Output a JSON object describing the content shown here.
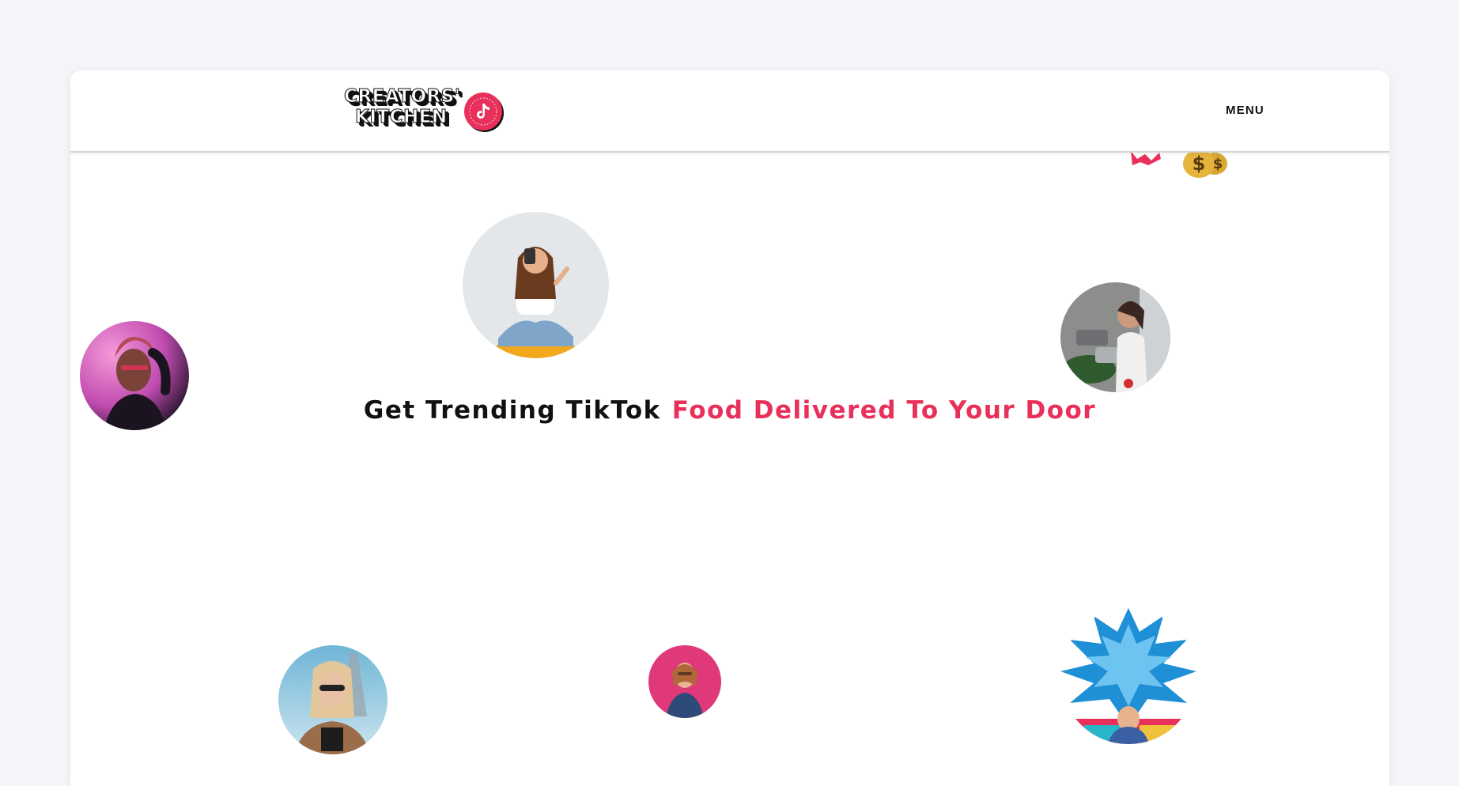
{
  "header": {
    "logo": {
      "line1": "CREATORS'",
      "line2": "KITCHEN",
      "badge_icon": "tiktok-note-icon",
      "badge_color": "#e8305a"
    },
    "menu_label": "MENU"
  },
  "hero": {
    "headline_part1": "Get Trending TikTok",
    "headline_part2": "Food Delivered To Your Door",
    "accent_color": "#e8305a",
    "text_color": "#111111"
  },
  "avatars": [
    {
      "name": "creator-avatar-1",
      "icon": "person-sitting-selfie"
    },
    {
      "name": "creator-avatar-2",
      "icon": "person-pink-light"
    },
    {
      "name": "creator-avatar-3",
      "icon": "person-cooking"
    },
    {
      "name": "creator-avatar-4",
      "icon": "person-sunglasses"
    },
    {
      "name": "creator-avatar-5",
      "icon": "person-pink-wall"
    },
    {
      "name": "creator-avatar-6",
      "icon": "person-blue-mural"
    }
  ],
  "decorations": {
    "money_bag_icon": "money-bag-icon",
    "ribbon_icon": "ribbon-icon"
  }
}
